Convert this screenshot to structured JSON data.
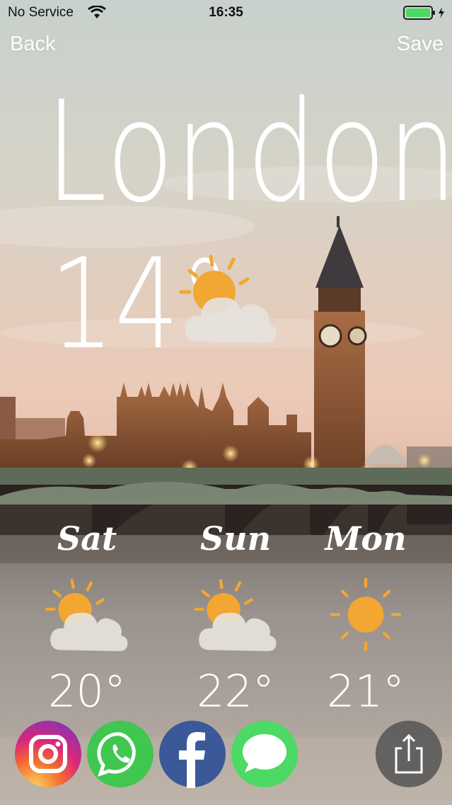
{
  "status_bar": {
    "carrier": "No Service",
    "time": "16:35"
  },
  "nav": {
    "back_label": "Back",
    "save_label": "Save"
  },
  "city": "London",
  "current": {
    "temperature": "14°",
    "icon": "partly-cloudy-icon"
  },
  "forecast": [
    {
      "day": "Sat",
      "high": "20°",
      "icon": "partly-cloudy-icon"
    },
    {
      "day": "Sun",
      "high": "22°",
      "icon": "partly-cloudy-icon"
    },
    {
      "day": "Mon",
      "high": "21°",
      "icon": "sunny-icon"
    }
  ],
  "share": [
    {
      "name": "instagram-icon",
      "color": "#C13584"
    },
    {
      "name": "whatsapp-icon",
      "color": "#25D366"
    },
    {
      "name": "facebook-icon",
      "color": "#3B5998"
    },
    {
      "name": "messages-icon",
      "color": "#4CD964"
    },
    {
      "name": "share-icon",
      "color": "#555555"
    }
  ]
}
